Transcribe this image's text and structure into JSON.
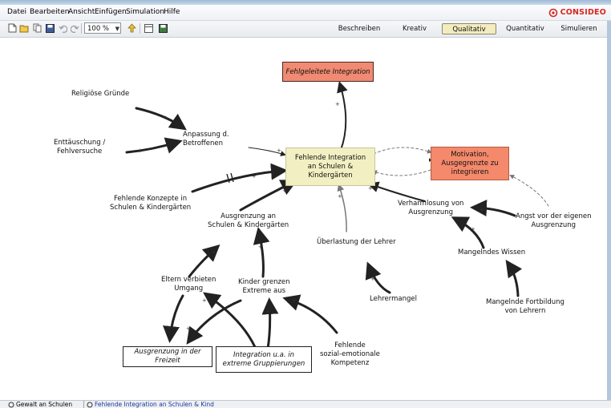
{
  "menu": {
    "items": [
      {
        "label": "Datei"
      },
      {
        "label": "Bearbeiten"
      },
      {
        "label": "Ansicht"
      },
      {
        "label": "Einfügen"
      },
      {
        "label": "Simulation"
      },
      {
        "label": "Hilfe"
      }
    ],
    "logo_text": "CONSIDEO"
  },
  "toolbar": {
    "zoom_value": "100 %",
    "modes": [
      {
        "label": "Beschreiben",
        "active": false
      },
      {
        "label": "Kreativ",
        "active": false
      },
      {
        "label": "Qualitativ",
        "active": true
      },
      {
        "label": "Quantitativ",
        "active": false
      },
      {
        "label": "Simulieren",
        "active": false
      }
    ]
  },
  "diagram": {
    "nodes": {
      "fehlgeleitete": "Fehlgeleitete Integration",
      "religioese": "Religiöse Gründe",
      "anpassung_1": "Anpassung d.",
      "anpassung_2": "Betroffenen",
      "enttaeuschung_1": "Enttäuschung /",
      "enttaeuschung_2": "Fehlversuche",
      "main_1": "Fehlende Integration",
      "main_2": "an Schulen &",
      "main_3": "Kindergärten",
      "motivation_1": "Motivation,",
      "motivation_2": "Ausgegrenzte zu",
      "motivation_3": "integrieren",
      "konzepte_1": "Fehlende Konzepte in",
      "konzepte_2": "Schulen & Kindergärten",
      "verharmlosung_1": "Verharmlosung von",
      "verharmlosung_2": "Ausgrenzung",
      "angst_1": "Angst vor der eigenen",
      "angst_2": "Ausgrenzung",
      "ausgrenzung_1": "Ausgrenzung an",
      "ausgrenzung_2": "Schulen & Kindergärten",
      "ueberlastung": "Überlastung der Lehrer",
      "mangelndes": "Mangelndes Wissen",
      "eltern_1": "Eltern verbieten",
      "eltern_2": "Umgang",
      "kinder_1": "Kinder grenzen",
      "kinder_2": "Extreme aus",
      "lehrermangel": "Lehrermangel",
      "fortbildung_1": "Mangelnde Fortbildung",
      "fortbildung_2": "von Lehrern",
      "freizeit_1": "Ausgrenzung in der",
      "freizeit_2": "Freizeit",
      "integration_1": "Integration u.a. in",
      "integration_2": "extreme Gruppierungen",
      "sozial_1": "Fehlende",
      "sozial_2": "sozial-emotionale",
      "sozial_3": "Kompetenz"
    },
    "colors": {
      "red_box": "#f08a72",
      "main_box": "#f2f0c2",
      "orange_box": "#f4896b"
    }
  },
  "tabs": [
    {
      "label": "Gewalt an Schulen",
      "icon": "loop-icon"
    },
    {
      "label": "Fehlende Integration an Schulen & Kind",
      "icon": "loop-icon"
    }
  ]
}
